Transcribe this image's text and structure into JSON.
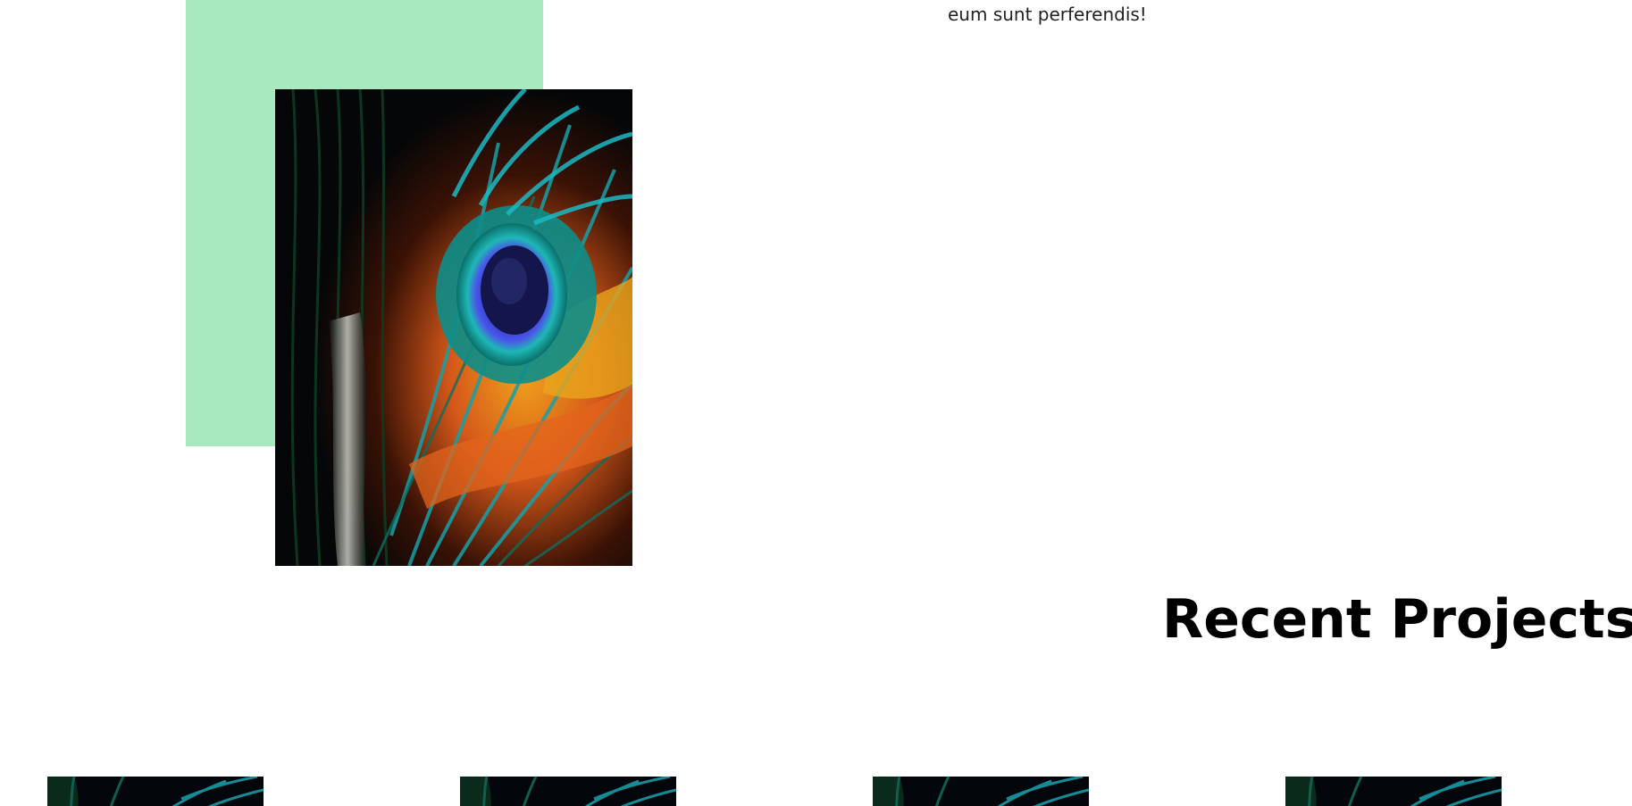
{
  "about": {
    "text_tail": "eum sunt perferendis!"
  },
  "feature_image": {
    "icon": "peacock-feather-photo",
    "colors": {
      "accent_block": "#a8e9c0",
      "teal": "#19a7b3",
      "blue": "#3a3fd6",
      "orange": "#e3641c",
      "yellow": "#e9a51b"
    }
  },
  "recent_projects": {
    "title": "Recent Projects",
    "items": [
      {
        "icon": "peacock-feather-thumbnail"
      },
      {
        "icon": "peacock-feather-thumbnail"
      },
      {
        "icon": "peacock-feather-thumbnail"
      },
      {
        "icon": "peacock-feather-thumbnail"
      }
    ]
  }
}
